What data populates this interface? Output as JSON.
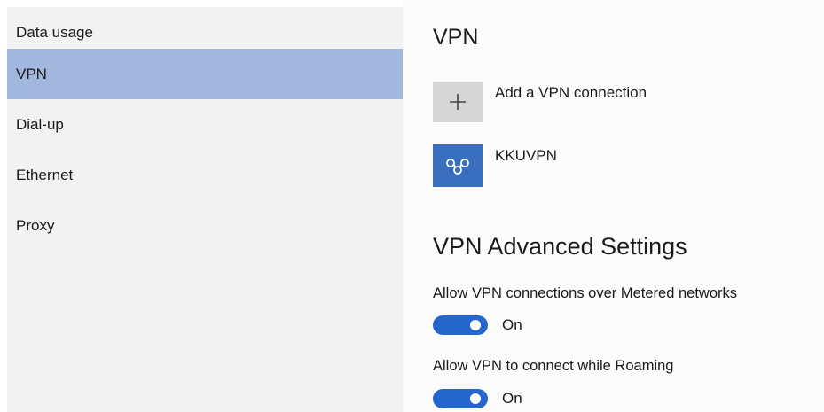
{
  "sidebar": {
    "items": [
      {
        "label": "Data usage"
      },
      {
        "label": "VPN",
        "selected": true
      },
      {
        "label": "Dial-up"
      },
      {
        "label": "Ethernet"
      },
      {
        "label": "Proxy"
      }
    ]
  },
  "main": {
    "title": "VPN",
    "add_connection": {
      "label": "Add a VPN connection",
      "icon": "plus-icon"
    },
    "connections": [
      {
        "name": "KKUVPN",
        "icon": "vpn-connection-icon"
      }
    ],
    "advanced_title": "VPN Advanced Settings",
    "settings": [
      {
        "label": "Allow VPN connections over Metered networks",
        "state": "On"
      },
      {
        "label": "Allow VPN to connect while Roaming",
        "state": "On"
      }
    ]
  },
  "colors": {
    "selected_nav": "#a2b7de",
    "toggle_on": "#2466cc",
    "vpn_tile": "#3a6fbf"
  }
}
